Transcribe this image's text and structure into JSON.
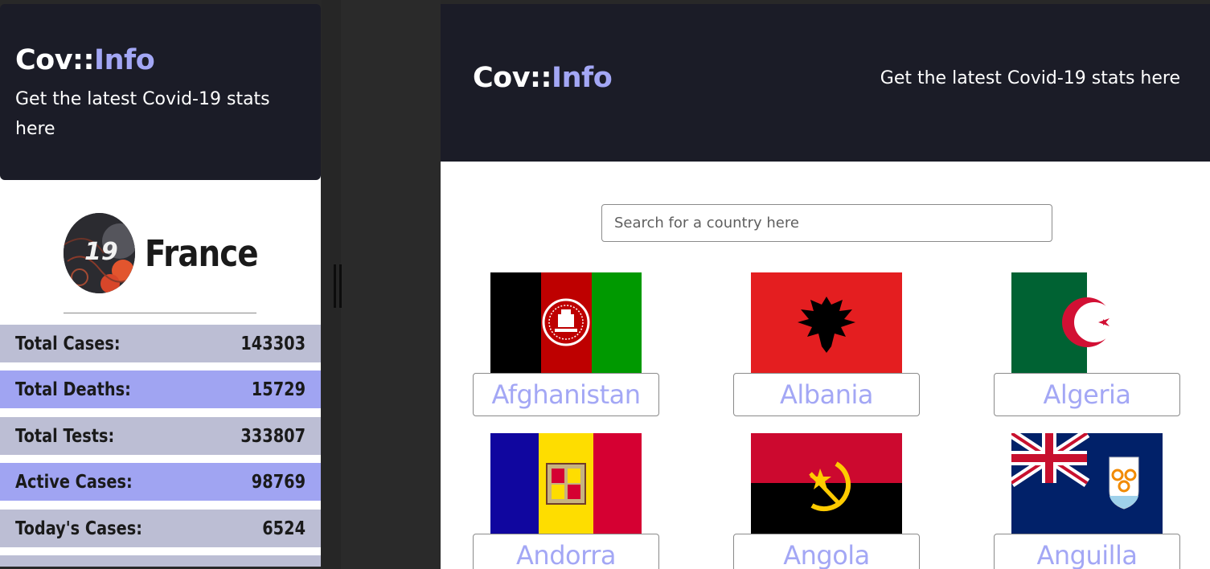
{
  "brand": {
    "prefix": "Cov::",
    "accent": "Info"
  },
  "tagline": "Get the latest Covid-19 stats here",
  "colors": {
    "header_bg": "#1b1c27",
    "accent": "#a3a7f5",
    "row_a": "#bcbed4",
    "row_b": "#a0a4f2"
  },
  "detail": {
    "badge_number": "19",
    "country": "France",
    "stats": [
      {
        "label": "Total Cases:",
        "value": "143303"
      },
      {
        "label": "Total Deaths:",
        "value": "15729"
      },
      {
        "label": "Total Tests:",
        "value": "333807"
      },
      {
        "label": "Active Cases:",
        "value": "98769"
      },
      {
        "label": "Today's Cases:",
        "value": "6524"
      }
    ]
  },
  "search": {
    "placeholder": "Search for a country here",
    "value": ""
  },
  "countries": [
    {
      "name": "Afghanistan",
      "flag_icon": "afghanistan-flag-icon"
    },
    {
      "name": "Albania",
      "flag_icon": "albania-flag-icon"
    },
    {
      "name": "Algeria",
      "flag_icon": "algeria-flag-icon"
    },
    {
      "name": "Andorra",
      "flag_icon": "andorra-flag-icon"
    },
    {
      "name": "Angola",
      "flag_icon": "angola-flag-icon"
    },
    {
      "name": "Anguilla",
      "flag_icon": "anguilla-flag-icon"
    }
  ]
}
